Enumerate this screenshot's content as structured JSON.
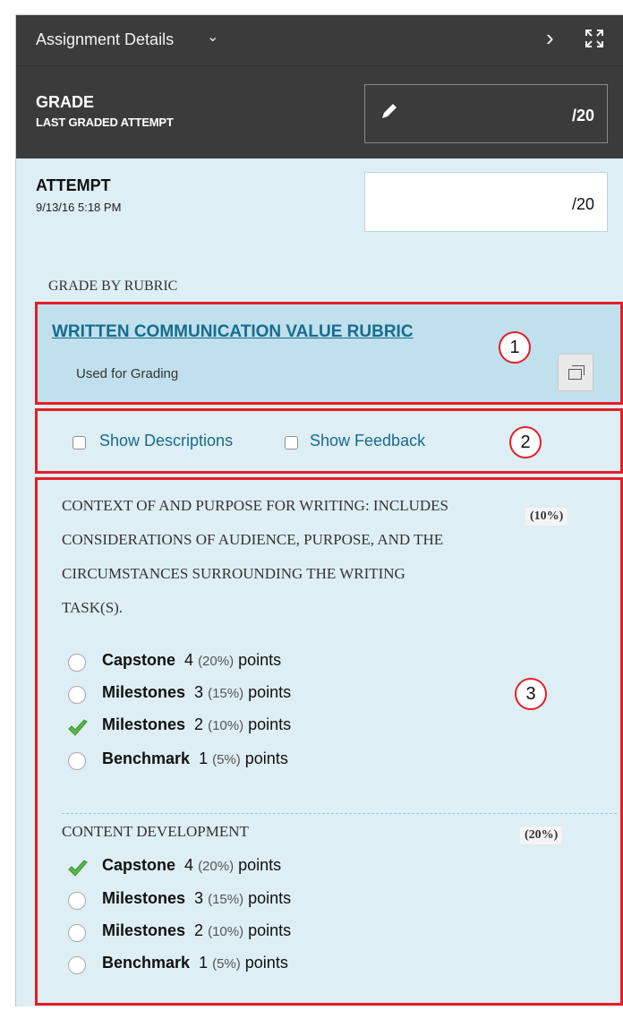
{
  "header": {
    "title": "Assignment Details",
    "grade_label": "GRADE",
    "grade_sublabel": "LAST GRADED ATTEMPT",
    "grade_value": "/20"
  },
  "attempt": {
    "label": "ATTEMPT",
    "date": "9/13/16 5:18 PM",
    "value": "/20"
  },
  "rubric": {
    "section_label": "GRADE BY RUBRIC",
    "name": "WRITTEN COMMUNICATION VALUE RUBRIC",
    "status": "Used for Grading",
    "show_descriptions": "Show Descriptions",
    "show_feedback": "Show Feedback"
  },
  "callouts": [
    "1",
    "2",
    "3"
  ],
  "criteria": [
    {
      "lines": [
        "CONTEXT OF AND PURPOSE FOR WRITING: INCLUDES",
        "CONSIDERATIONS OF AUDIENCE, PURPOSE, AND THE",
        "CIRCUMSTANCES SURROUNDING THE WRITING",
        "TASK(S)."
      ],
      "weight": "(10%)",
      "levels": [
        {
          "name": "Capstone",
          "score": "4",
          "pct": "(20%)",
          "unit": "points",
          "selected": false
        },
        {
          "name": "Milestones",
          "score": "3",
          "pct": "(15%)",
          "unit": "points",
          "selected": false
        },
        {
          "name": "Milestones",
          "score": "2",
          "pct": "(10%)",
          "unit": "points",
          "selected": true
        },
        {
          "name": "Benchmark",
          "score": "1",
          "pct": "(5%)",
          "unit": "points",
          "selected": false
        }
      ]
    },
    {
      "lines": [
        "CONTENT DEVELOPMENT"
      ],
      "weight": "(20%)",
      "levels": [
        {
          "name": "Capstone",
          "score": "4",
          "pct": "(20%)",
          "unit": "points",
          "selected": true
        },
        {
          "name": "Milestones",
          "score": "3",
          "pct": "(15%)",
          "unit": "points",
          "selected": false
        },
        {
          "name": "Milestones",
          "score": "2",
          "pct": "(10%)",
          "unit": "points",
          "selected": false
        },
        {
          "name": "Benchmark",
          "score": "1",
          "pct": "(5%)",
          "unit": "points",
          "selected": false
        }
      ]
    }
  ],
  "colors": {
    "header_bg": "#3b3b3b",
    "panel_bg": "#ddeef4",
    "rubric_bg": "#bfe0ec",
    "link": "#176b8f",
    "annotation_red": "#e41e26",
    "check_green": "#58b947"
  },
  "icons": {
    "title_dropdown": "chevron-down-icon",
    "next": "chevron-right-icon",
    "expand": "expand-icon",
    "edit_grade": "pencil-icon",
    "rubric_popout": "popout-icon",
    "selected_level": "checkmark-icon"
  }
}
